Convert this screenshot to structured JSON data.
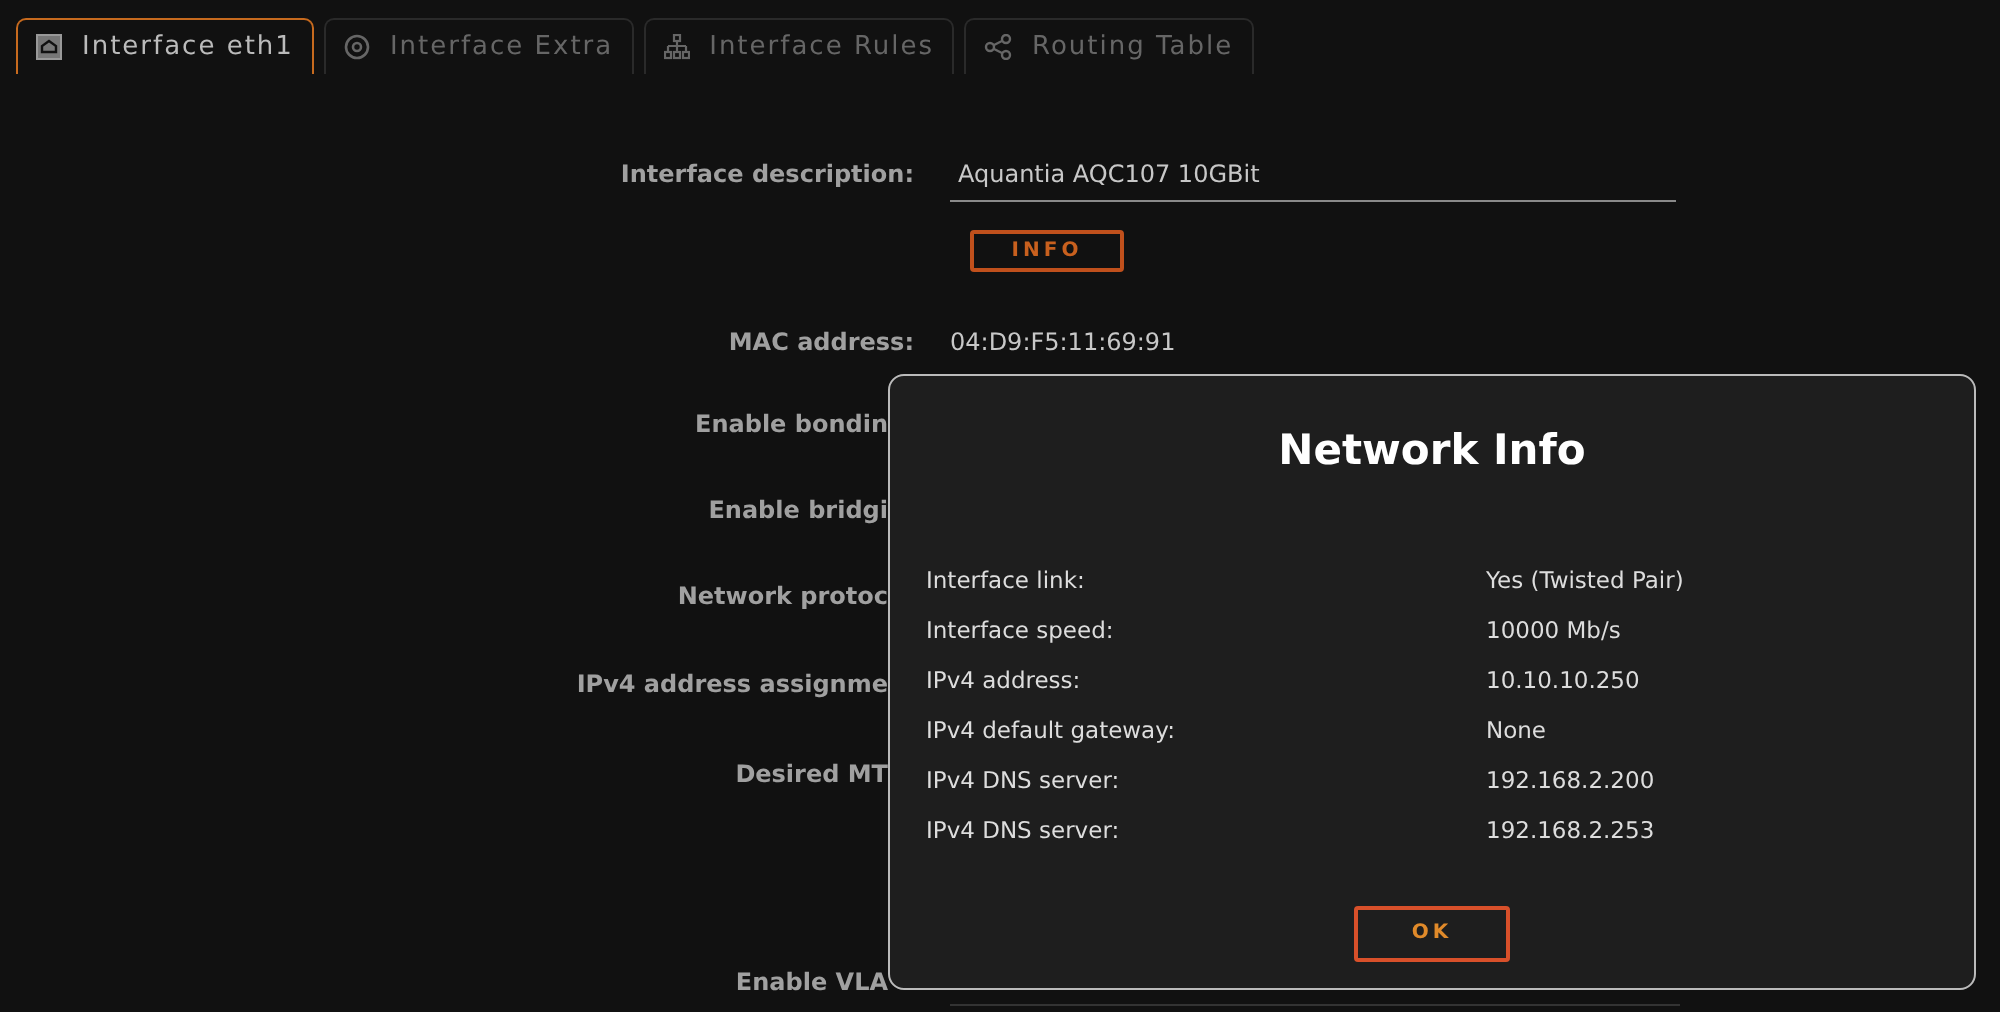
{
  "tabs": [
    {
      "label": "Interface eth1",
      "selected": true
    },
    {
      "label": "Interface Extra",
      "selected": false
    },
    {
      "label": "Interface Rules",
      "selected": false
    },
    {
      "label": "Routing Table",
      "selected": false
    }
  ],
  "form": {
    "description_label": "Interface description:",
    "description_value": "Aquantia AQC107 10GBit",
    "info_button": "INFO",
    "mac_label": "MAC address:",
    "mac_value": "04:D9:F5:11:69:91",
    "hidden_labels": [
      "Enable bondin",
      "Enable bridgi",
      "Network protoc",
      "IPv4 address assignme",
      "Desired MT",
      "Enable VLA"
    ]
  },
  "dialog": {
    "title": "Network Info",
    "rows": [
      {
        "label": "Interface link:",
        "value": "Yes (Twisted Pair)"
      },
      {
        "label": "Interface speed:",
        "value": "10000 Mb/s"
      },
      {
        "label": "IPv4 address:",
        "value": "10.10.10.250"
      },
      {
        "label": "IPv4 default gateway:",
        "value": "None"
      },
      {
        "label": "IPv4 DNS server:",
        "value": "192.168.2.200"
      },
      {
        "label": "IPv4 DNS server:",
        "value": "192.168.2.253"
      }
    ],
    "ok_button": "OK"
  }
}
